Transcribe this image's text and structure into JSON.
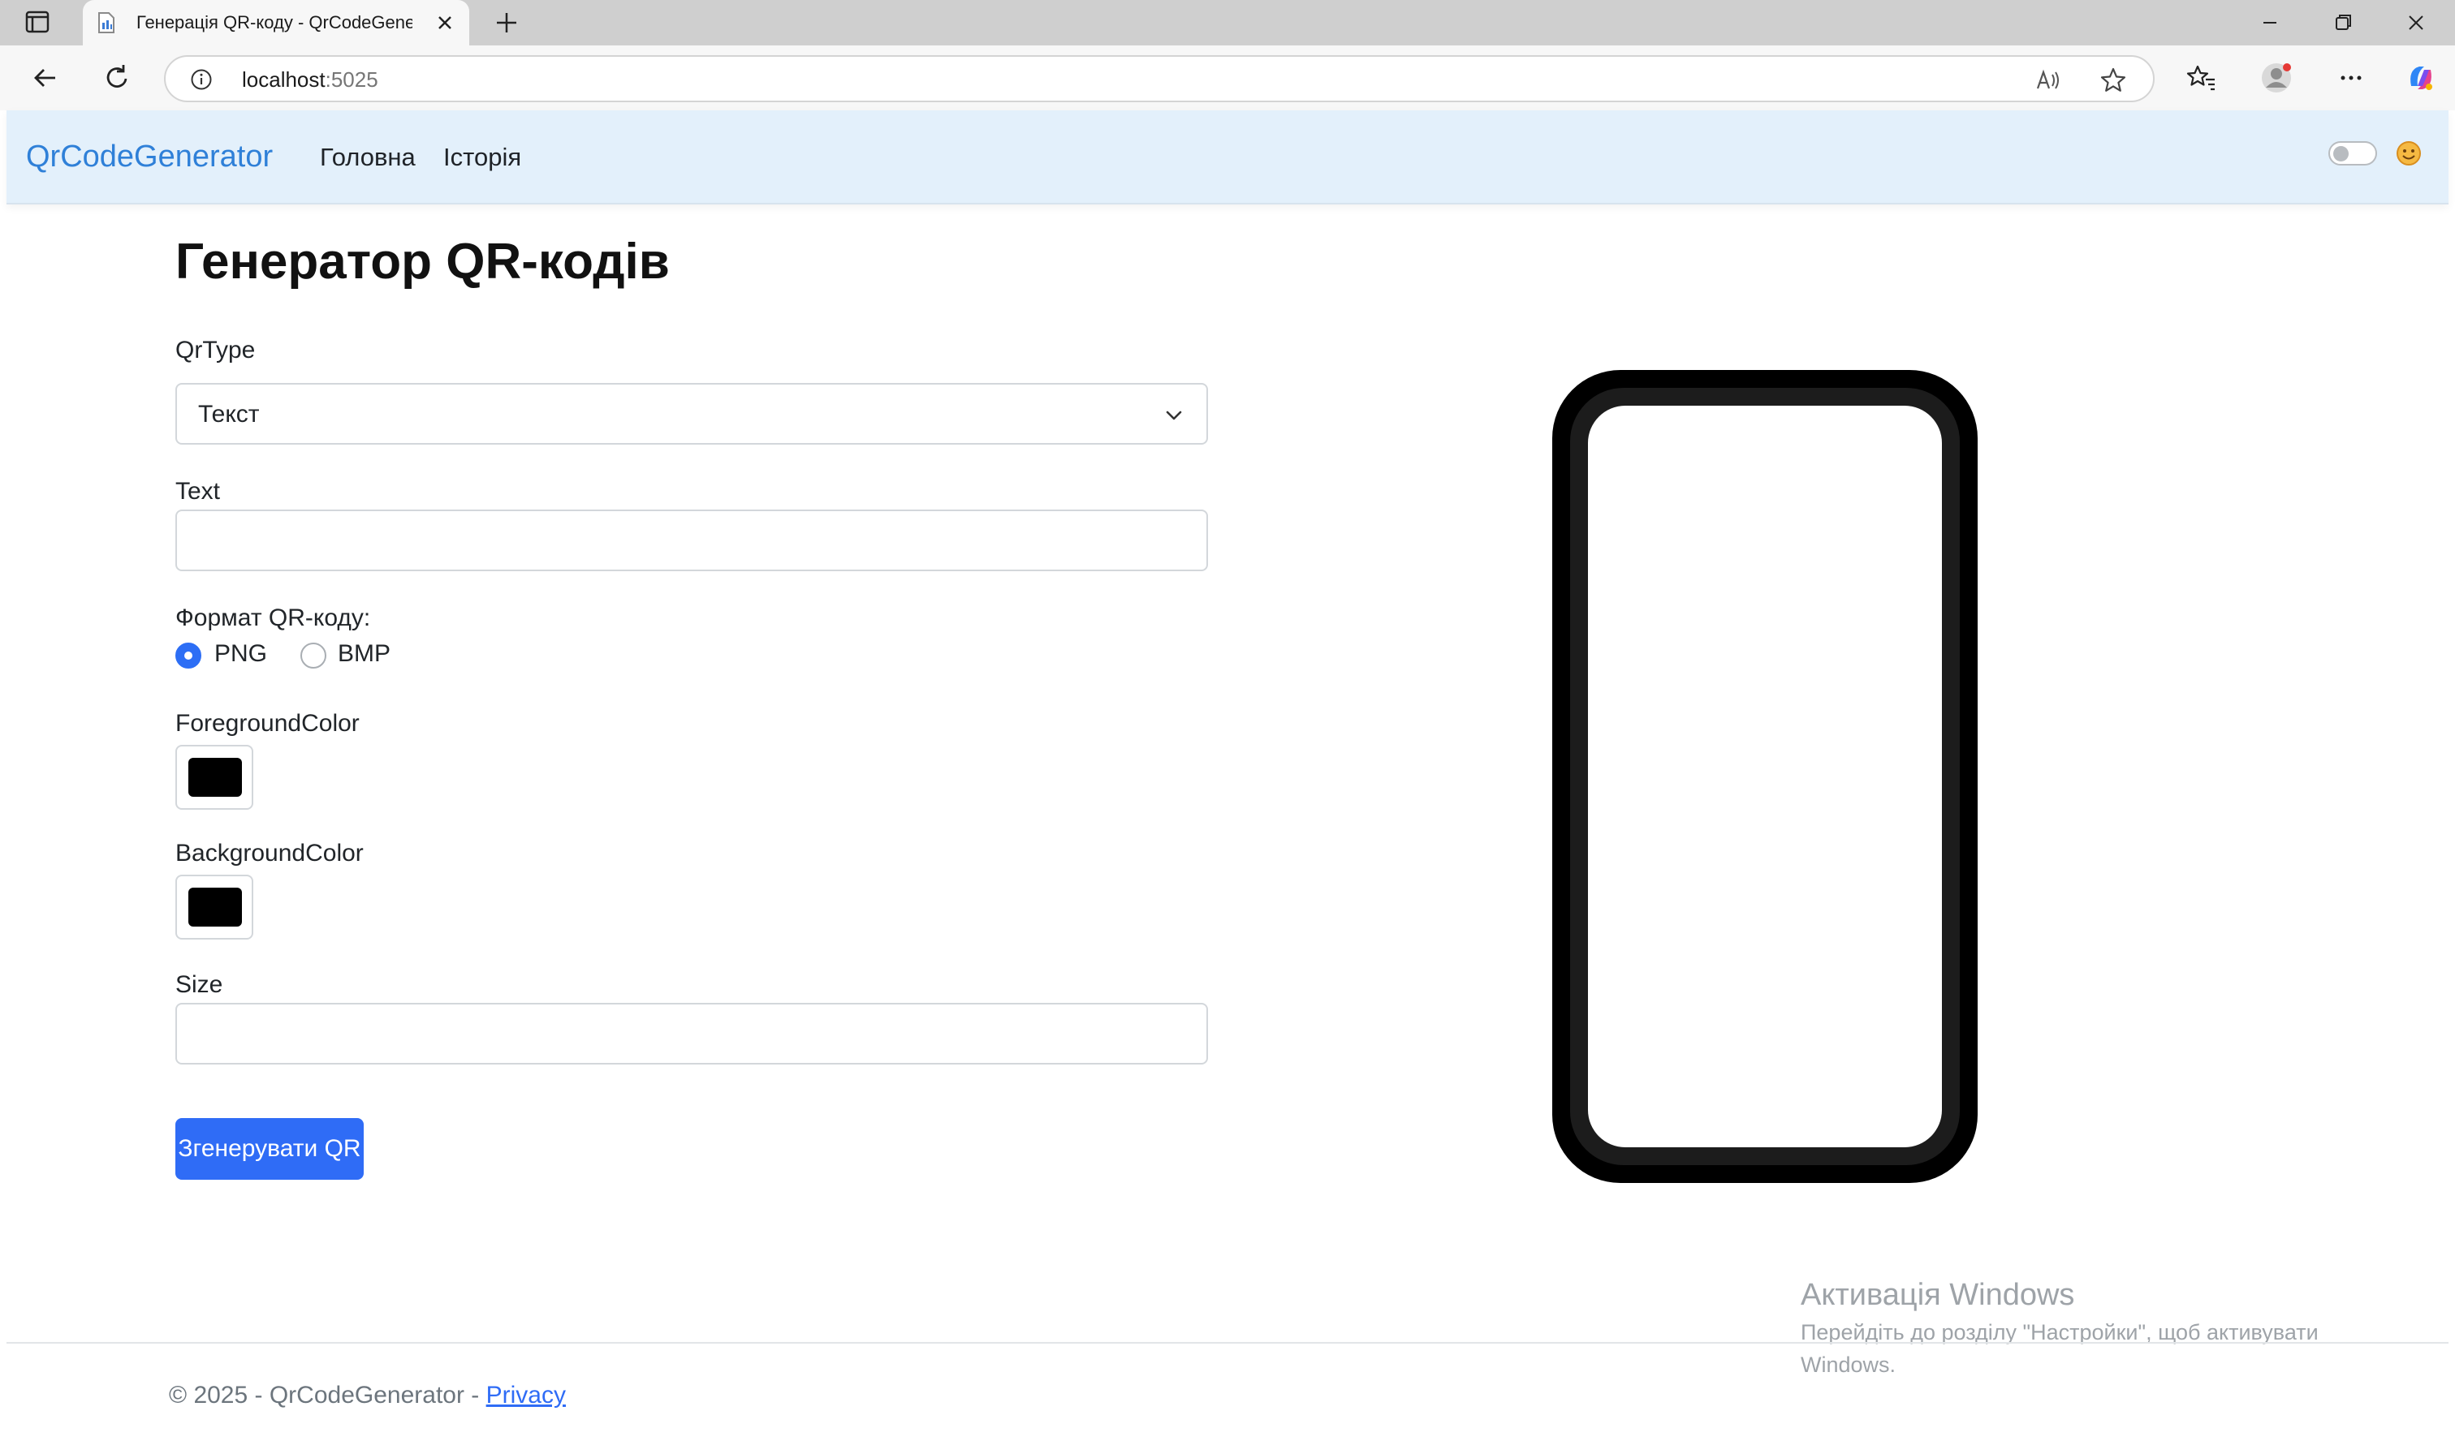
{
  "browser": {
    "tab_title": "Генерація QR-коду - QrCodeGenerator",
    "address_host": "localhost",
    "address_port": ":5025",
    "colors": {
      "frame": "#cfcfcf",
      "toolbar": "#f7f7f7"
    },
    "icons": [
      "tab-actions-icon",
      "page-favicon",
      "close-icon",
      "plus-icon",
      "minimize-icon",
      "restore-icon",
      "close-window-icon",
      "back-icon",
      "reload-icon",
      "info-icon",
      "read-aloud-icon",
      "star-icon",
      "favorites-icon",
      "profile-icon",
      "more-icon",
      "copilot-icon"
    ]
  },
  "navbar": {
    "brand": "QrCodeGenerator",
    "links": [
      "Головна",
      "Історія"
    ],
    "theme_toggle_on": false,
    "colors": {
      "background": "#e3f0fb",
      "brand": "#2f80d8"
    }
  },
  "form": {
    "title": "Генератор QR-кодів",
    "qr_type_label": "QrType",
    "qr_type_value": "Текст",
    "text_label": "Text",
    "text_value": "",
    "format_label": "Формат QR-коду:",
    "format_options": [
      {
        "label": "PNG",
        "checked": true
      },
      {
        "label": "BMP",
        "checked": false
      }
    ],
    "foreground_label": "ForegroundColor",
    "foreground_color": "#000000",
    "background_label": "BackgroundColor",
    "background_color": "#000000",
    "size_label": "Size",
    "size_value": "",
    "generate_button": "Згенерувати QR",
    "accent_color": "#2f6cf6"
  },
  "watermark": {
    "title": "Активація Windows",
    "text": "Перейдіть до розділу \"Настройки\", щоб активувати Windows."
  },
  "footer": {
    "text": "© 2025 - QrCodeGenerator - ",
    "link": "Privacy"
  }
}
